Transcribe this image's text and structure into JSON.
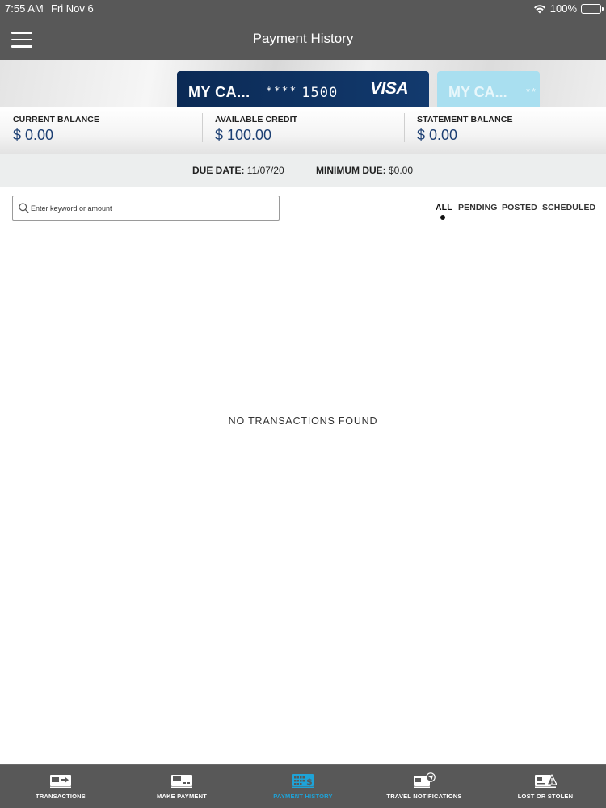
{
  "status_bar": {
    "time": "7:55 AM",
    "date": "Fri Nov 6",
    "battery": "100%"
  },
  "header": {
    "title": "Payment History"
  },
  "cards": [
    {
      "name": "MY CA...",
      "mask": "****",
      "last4": "1500",
      "network": "VISA",
      "color": "#0b2a55"
    },
    {
      "name": "MY CA...",
      "mask": "**",
      "color": "#a9dff0"
    }
  ],
  "balances": {
    "current_label": "CURRENT BALANCE",
    "current_value": "$ 0.00",
    "available_label": "AVAILABLE CREDIT",
    "available_value": "$ 100.00",
    "statement_label": "STATEMENT BALANCE",
    "statement_value": "$ 0.00"
  },
  "due": {
    "date_label": "DUE DATE:",
    "date_value": "11/07/20",
    "min_label": "MINIMUM DUE:",
    "min_value": "$0.00"
  },
  "search": {
    "placeholder": "Enter keyword or amount"
  },
  "filters": {
    "all": "ALL",
    "pending": "PENDING",
    "posted": "POSTED",
    "scheduled": "SCHEDULED",
    "selected": "ALL"
  },
  "empty_message": "NO TRANSACTIONS FOUND",
  "tabs": [
    {
      "label": "TRANSACTIONS",
      "icon": "transactions-icon"
    },
    {
      "label": "MAKE PAYMENT",
      "icon": "make-payment-icon"
    },
    {
      "label": "PAYMENT HISTORY",
      "icon": "payment-history-icon",
      "active": true
    },
    {
      "label": "TRAVEL NOTIFICATIONS",
      "icon": "travel-notifications-icon"
    },
    {
      "label": "LOST OR STOLEN",
      "icon": "lost-or-stolen-icon"
    }
  ],
  "colors": {
    "header_bg": "#585858",
    "accent": "#1ea3d8",
    "balance_value": "#1c3f73"
  }
}
